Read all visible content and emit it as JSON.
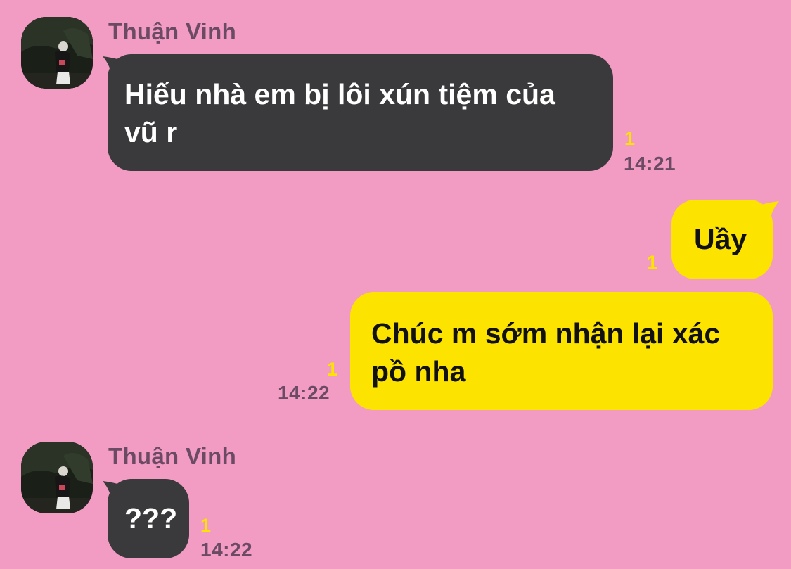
{
  "messages": [
    {
      "direction": "incoming",
      "sender": "Thuận Vinh",
      "text": "Hiếu nhà em bị lôi xún tiệm của vũ r",
      "unread": "1",
      "time": "14:21"
    },
    {
      "direction": "outgoing",
      "text": "Uầy",
      "unread": "1",
      "time": ""
    },
    {
      "direction": "outgoing",
      "text": "Chúc m sớm nhận lại xác pồ nha",
      "unread": "1",
      "time": "14:22"
    },
    {
      "direction": "incoming",
      "sender": "Thuận Vinh",
      "text": "???",
      "unread": "1",
      "time": "14:22"
    }
  ],
  "colors": {
    "background": "#f29bc3",
    "incoming_bubble": "#3a3a3c",
    "outgoing_bubble": "#fde300",
    "unread_count": "#fde300",
    "meta_text": "#6b4a63"
  },
  "icons": {
    "avatar": "user-avatar-photo"
  }
}
